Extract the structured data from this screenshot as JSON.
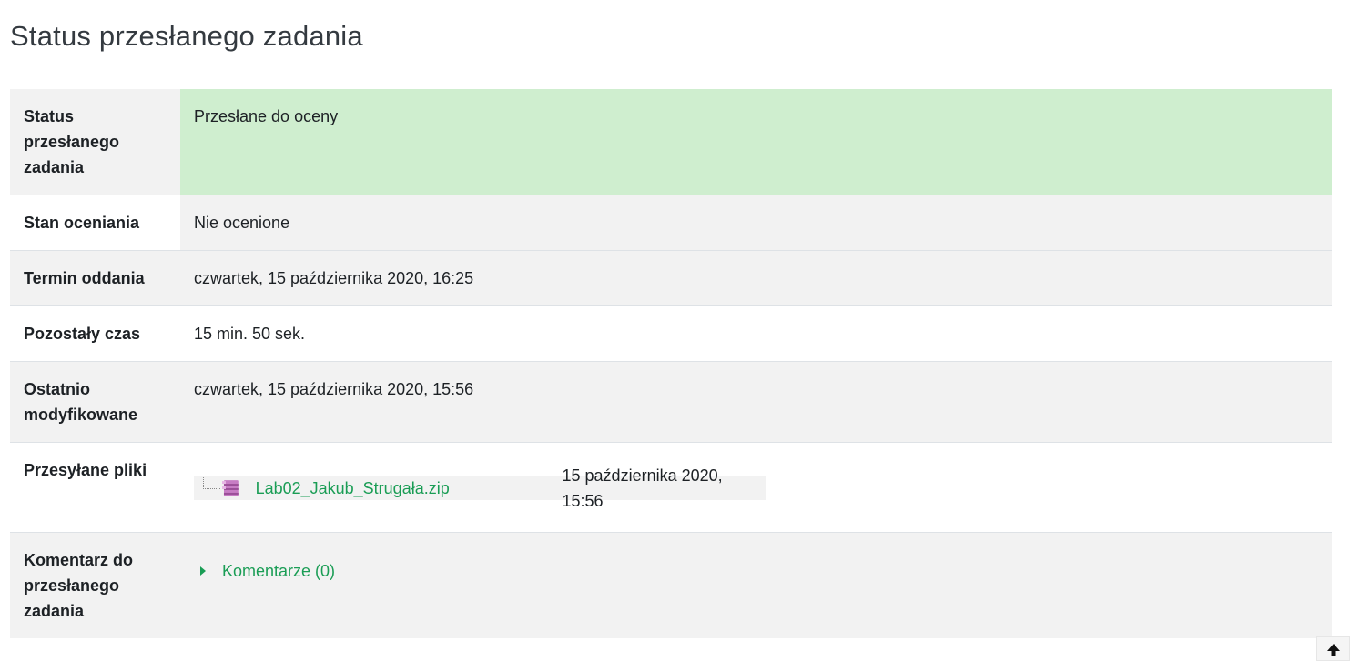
{
  "page_title": "Status przesłanego zadania",
  "rows": {
    "submission_status": {
      "label": "Status przesłanego zadania",
      "value": "Przesłane do oceny",
      "status_color": "#cfeecf"
    },
    "grading_status": {
      "label": "Stan oceniania",
      "value": "Nie ocenione"
    },
    "due_date": {
      "label": "Termin oddania",
      "value": "czwartek, 15 października 2020, 16:25"
    },
    "time_remaining": {
      "label": "Pozostały czas",
      "value": "15 min. 50 sek."
    },
    "last_modified": {
      "label": "Ostatnio modyfikowane",
      "value": "czwartek, 15 października 2020, 15:56"
    },
    "file_submissions": {
      "label": "Przesyłane pliki",
      "files": [
        {
          "name": "Lab02_Jakub_Strugała.zip",
          "date": "15 października 2020, 15:56",
          "icon": "zip-archive-icon"
        }
      ]
    },
    "submission_comments": {
      "label": "Komentarz do przesłanego zadania",
      "toggle_label": "Komentarze (0)",
      "icon": "caret-right-icon"
    }
  },
  "scroll_top": {
    "icon": "arrow-up-icon"
  },
  "colors": {
    "link": "#1a9d55",
    "row_shade": "#f2f2f2",
    "status_success": "#cfeecf"
  }
}
